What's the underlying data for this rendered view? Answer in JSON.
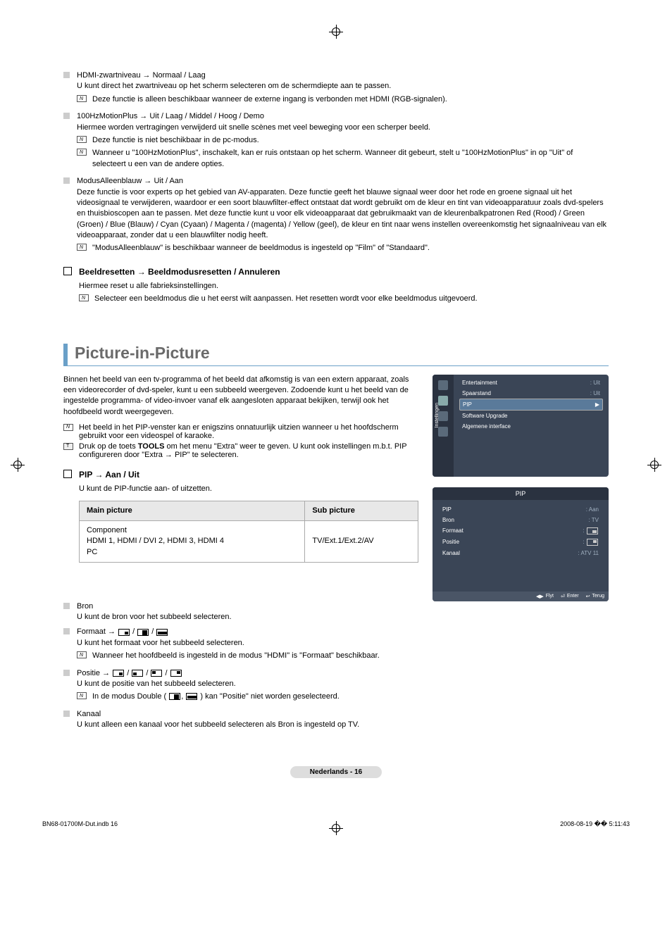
{
  "items": {
    "hdmi": {
      "title": "HDMI-zwartniveau → Normaal / Laag",
      "desc": "U kunt direct het zwartniveau op het scherm selecteren om de schermdiepte aan te passen.",
      "note": "Deze functie is alleen beschikbaar wanneer de externe ingang is verbonden met HDMI (RGB-signalen)."
    },
    "motion": {
      "title": "100HzMotionPlus → Uit / Laag / Middel / Hoog / Demo",
      "desc": "Hiermee worden vertragingen verwijderd uit snelle scènes met veel beweging voor een scherper beeld.",
      "note1": "Deze functie is niet beschikbaar in de pc-modus.",
      "note2": "Wanneer u \"100HzMotionPlus\", inschakelt, kan er ruis ontstaan op het scherm. Wanneer dit gebeurt, stelt u \"100HzMotionPlus\" in op \"Uit\" of selecteert u een van de andere opties."
    },
    "blue": {
      "title": "ModusAlleenblauw → Uit / Aan",
      "desc": "Deze functie is voor experts op het gebied van AV-apparaten. Deze functie geeft het blauwe signaal weer door het rode en groene signaal uit het videosignaal te verwijderen, waardoor er een soort blauwfilter-effect ontstaat dat wordt gebruikt om de kleur en tint van videoapparatuur zoals dvd-spelers en thuisbioscopen aan te passen. Met deze functie kunt u voor elk videoapparaat dat gebruikmaakt van de kleurenbalkpatronen Red (Rood) / Green (Groen) / Blue (Blauw) / Cyan (Cyaan) / Magenta / (magenta) / Yellow (geel), de kleur en tint naar wens instellen overeenkomstig het signaalniveau van elk videoapparaat, zonder dat u een blauwfilter nodig heeft.",
      "note": "\"ModusAlleenblauw\" is beschikbaar wanneer de beeldmodus is ingesteld op \"Film\" of \"Standaard\"."
    }
  },
  "reset": {
    "title": "Beeldresetten → Beeldmodusresetten / Annuleren",
    "desc": "Hiermee reset u alle fabrieksinstellingen.",
    "note": "Selecteer een beeldmodus die u het eerst wilt aanpassen. Het resetten wordt voor elke beeldmodus uitgevoerd."
  },
  "pip": {
    "heading": "Picture-in-Picture",
    "intro": "Binnen het beeld van een tv-programma of het beeld dat afkomstig is van een extern apparaat, zoals een videorecorder of dvd-speler, kunt u een subbeeld weergeven. Zodoende kunt u het beeld van de ingestelde programma- of video-invoer vanaf elk aangesloten apparaat bekijken, terwijl ook het hoofdbeeld wordt weergegeven.",
    "note1": "Het beeld in het PIP-venster kan er enigszins onnatuurlijk uitzien wanneer u het hoofdscherm gebruikt voor een videospel of karaoke.",
    "tool_pre": "Druk op de toets ",
    "tool_bold": "TOOLS",
    "tool_post": " om het menu \"Extra\" weer te geven. U kunt ook instellingen m.b.t. PIP configureren door \"Extra → PIP\" te selecteren.",
    "onoff": {
      "title": "PIP → Aan / Uit",
      "desc": "U kunt de PIP-functie aan- of uitzetten."
    },
    "table": {
      "h1": "Main picture",
      "h2": "Sub picture",
      "c1a": "Component",
      "c1b": "HDMI 1, HDMI / DVI 2, HDMI 3, HDMI 4",
      "c1c": "PC",
      "c2": "TV/Ext.1/Ext.2/AV"
    },
    "bron": {
      "title": "Bron",
      "desc": "U kunt de bron voor het subbeeld selecteren."
    },
    "format": {
      "title": "Formaat → ",
      "desc": "U kunt het formaat voor het subbeeld selecteren.",
      "note": "Wanneer het hoofdbeeld is ingesteld in de modus \"HDMI\" is \"Formaat\" beschikbaar."
    },
    "positie": {
      "title": "Positie → ",
      "desc": "U kunt de positie van het subbeeld selecteren.",
      "note_pre": "In de modus Double ( ",
      "note_post": " ) kan \"Positie\" niet worden geselecteerd."
    },
    "kanaal": {
      "title": "Kanaal",
      "desc": "U kunt alleen een kanaal voor het subbeeld selecteren als Bron is ingesteld op TV."
    }
  },
  "menu1": {
    "sidebar": "Instellingen",
    "entertainment": "Entertainment",
    "entertainment_v": ": Uit",
    "spaarstand": "Spaarstand",
    "spaarstand_v": ": Uit",
    "pip": "PIP",
    "software": "Software Upgrade",
    "interface": "Algemene interface"
  },
  "menu2": {
    "header": "PIP",
    "pip": "PIP",
    "pip_v": ": Aan",
    "bron": "Bron",
    "bron_v": ": TV",
    "formaat": "Formaat",
    "positie": "Positie",
    "kanaal": "Kanaal",
    "kanaal_v": ": ATV 11",
    "flyt": "Flyt",
    "enter": "Enter",
    "terug": "Terug"
  },
  "page": "Nederlands - 16",
  "footer": {
    "left": "BN68-01700M-Dut.indb   16",
    "right": "2008-08-19   �� 5:11:43"
  }
}
